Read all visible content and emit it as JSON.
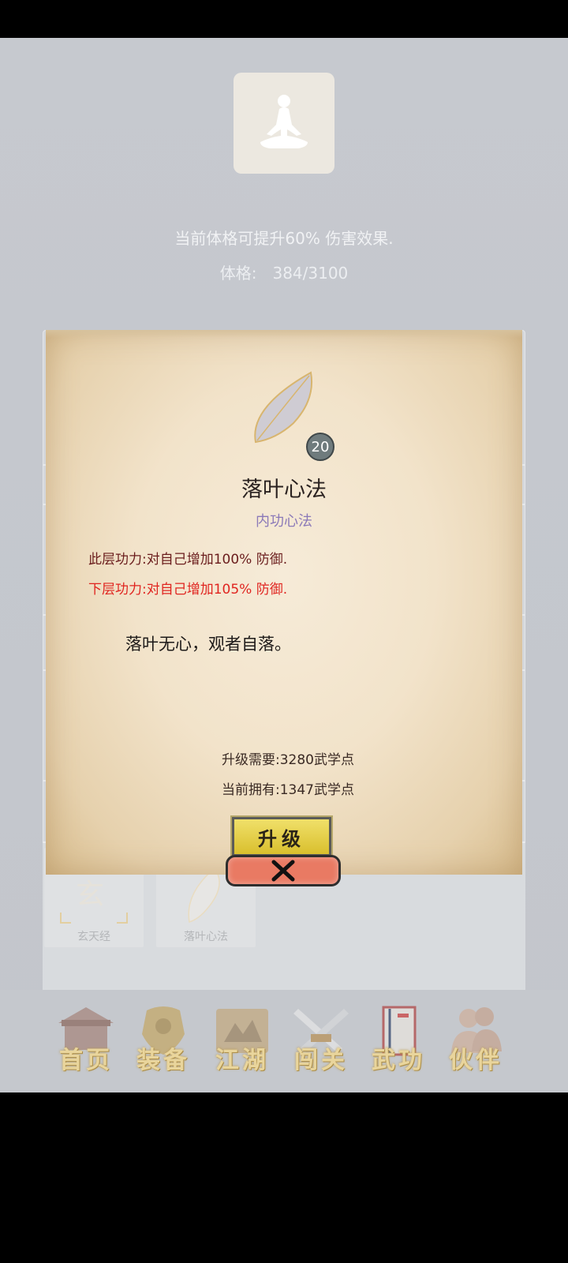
{
  "background": {
    "description": "当前体格可提升60% 伤害效果.",
    "stat_label": "体格:",
    "stat_value": "384/3100",
    "avatar_icon": "meditating-figure-icon",
    "skill_tiles": [
      {
        "label": "玄天经",
        "icon": "xuan-scroll-icon"
      },
      {
        "label": "落叶心法",
        "icon": "leaf-icon"
      }
    ]
  },
  "modal": {
    "icon": "leaf-icon",
    "level": "20",
    "name": "落叶心法",
    "type": "内功心法",
    "effect_current": "此层功力:对自己增加100% 防御.",
    "effect_next": "下层功力:对自己增加105% 防御.",
    "flavor": "落叶无心，观者自落。",
    "cost_required": "升级需要:3280武学点",
    "cost_owned": "当前拥有:1347武学点",
    "upgrade_label": "升级",
    "close_icon": "close-x-icon"
  },
  "nav": {
    "items": [
      {
        "label": "首页",
        "icon": "house-icon"
      },
      {
        "label": "装备",
        "icon": "armor-icon"
      },
      {
        "label": "江湖",
        "icon": "map-scroll-icon"
      },
      {
        "label": "闯关",
        "icon": "crossed-swords-icon"
      },
      {
        "label": "武功",
        "icon": "book-icon"
      },
      {
        "label": "伙伴",
        "icon": "companions-icon"
      }
    ]
  },
  "colors": {
    "effect_current": "#6a1c1c",
    "effect_next": "#e0241f",
    "type_label": "#8b79b8",
    "upgrade_button": "#e6cf45",
    "close_button": "#e97a63"
  }
}
